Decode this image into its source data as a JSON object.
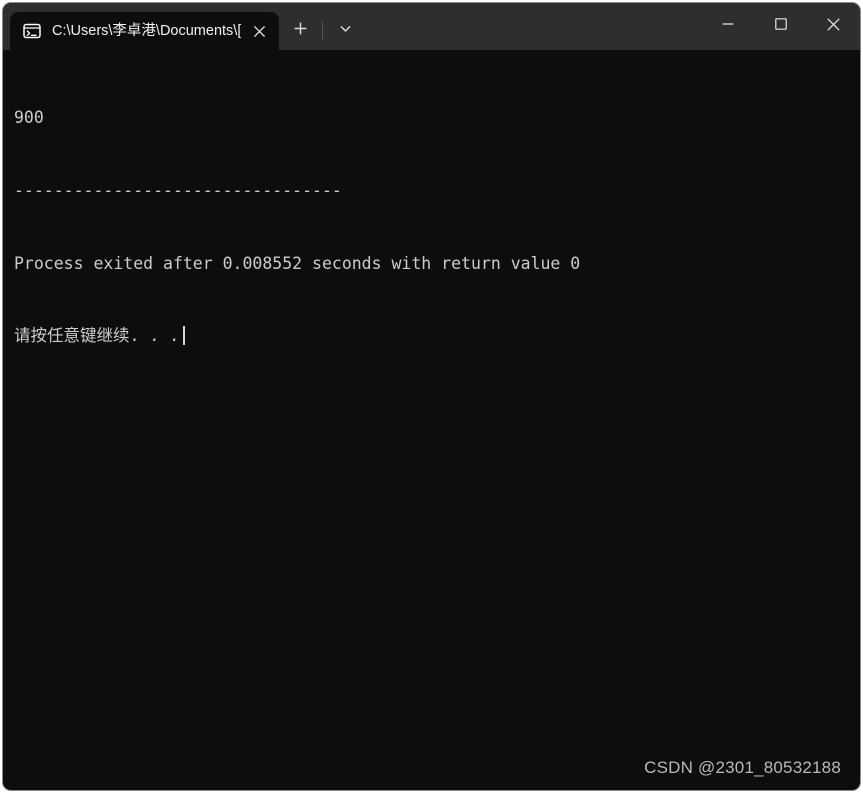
{
  "window": {
    "titlebar_color": "#2e2e2e",
    "terminal_background": "#0d0d0d",
    "terminal_foreground": "#cccccc",
    "border_color": "#8a8a8a"
  },
  "tabs": [
    {
      "icon": "command-prompt-icon",
      "icon_label": "C:\\",
      "title": "C:\\Users\\李卓港\\Documents\\[",
      "close_label": "✕",
      "active": true
    }
  ],
  "tabstrip": {
    "new_tab_label": "+",
    "new_tab_icon": "plus-icon",
    "dropdown_label": "⌄",
    "dropdown_icon": "chevron-down-icon"
  },
  "window_controls": {
    "minimize_label": "—",
    "minimize_icon": "minimize-icon",
    "maximize_label": "☐",
    "maximize_icon": "maximize-icon",
    "close_label": "✕",
    "close_icon": "close-icon"
  },
  "console": {
    "lines": [
      "900",
      "---------------------------------",
      "Process exited after 0.008552 seconds with return value 0",
      "请按任意键继续. . ."
    ],
    "output_value": "900",
    "separator": "---------------------------------",
    "exit_message": "Process exited after 0.008552 seconds with return value 0",
    "exit_seconds": "0.008552",
    "return_value": "0",
    "prompt_message": "请按任意键继续. . .",
    "cursor_visible": true
  },
  "watermark": {
    "text": "CSDN @2301_80532188"
  }
}
